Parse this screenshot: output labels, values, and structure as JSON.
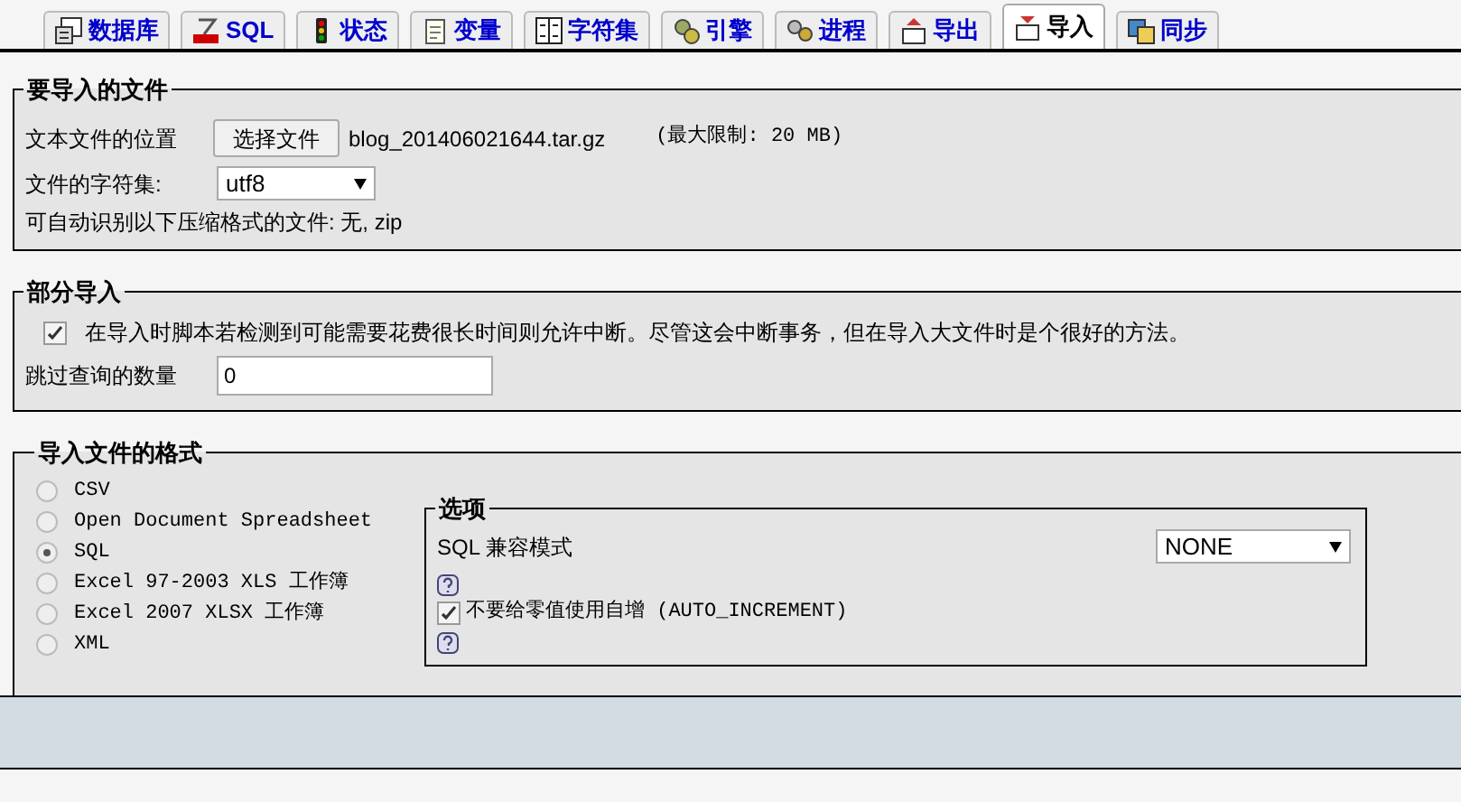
{
  "tabs": [
    {
      "label": "数据库",
      "selected": false
    },
    {
      "label": "SQL",
      "selected": false
    },
    {
      "label": "状态",
      "selected": false
    },
    {
      "label": "变量",
      "selected": false
    },
    {
      "label": "字符集",
      "selected": false
    },
    {
      "label": "引擎",
      "selected": false
    },
    {
      "label": "进程",
      "selected": false
    },
    {
      "label": "导出",
      "selected": false
    },
    {
      "label": "导入",
      "selected": true
    },
    {
      "label": "同步",
      "selected": false
    }
  ],
  "file_section": {
    "legend": "要导入的文件",
    "location_label": "文本文件的位置",
    "choose_button": "选择文件",
    "file_name": "blog_201406021644.tar.gz",
    "max_limit": "(最大限制: 20 MB)",
    "charset_label": "文件的字符集:",
    "charset_value": "utf8",
    "compression_note": "可自动识别以下压缩格式的文件: 无, zip"
  },
  "partial_section": {
    "legend": "部分导入",
    "allow_interrupt": {
      "label": "在导入时脚本若检测到可能需要花费很长时间则允许中断。尽管这会中断事务，但在导入大文件时是个很好的方法。",
      "checked": true
    },
    "skip_label": "跳过查询的数量",
    "skip_value": "0"
  },
  "format_section": {
    "legend": "导入文件的格式",
    "formats": [
      {
        "label": "CSV",
        "selected": false
      },
      {
        "label": "Open Document Spreadsheet",
        "selected": false
      },
      {
        "label": "SQL",
        "selected": true
      },
      {
        "label": "Excel 97-2003 XLS 工作簿",
        "selected": false
      },
      {
        "label": "Excel 2007 XLSX 工作簿",
        "selected": false
      },
      {
        "label": "XML",
        "selected": false
      }
    ],
    "options": {
      "legend": "选项",
      "compat_label": "SQL 兼容模式",
      "compat_value": "NONE",
      "no_auto_zero": {
        "label": "不要给零值使用自增 (AUTO_INCREMENT)",
        "checked": true
      }
    }
  }
}
